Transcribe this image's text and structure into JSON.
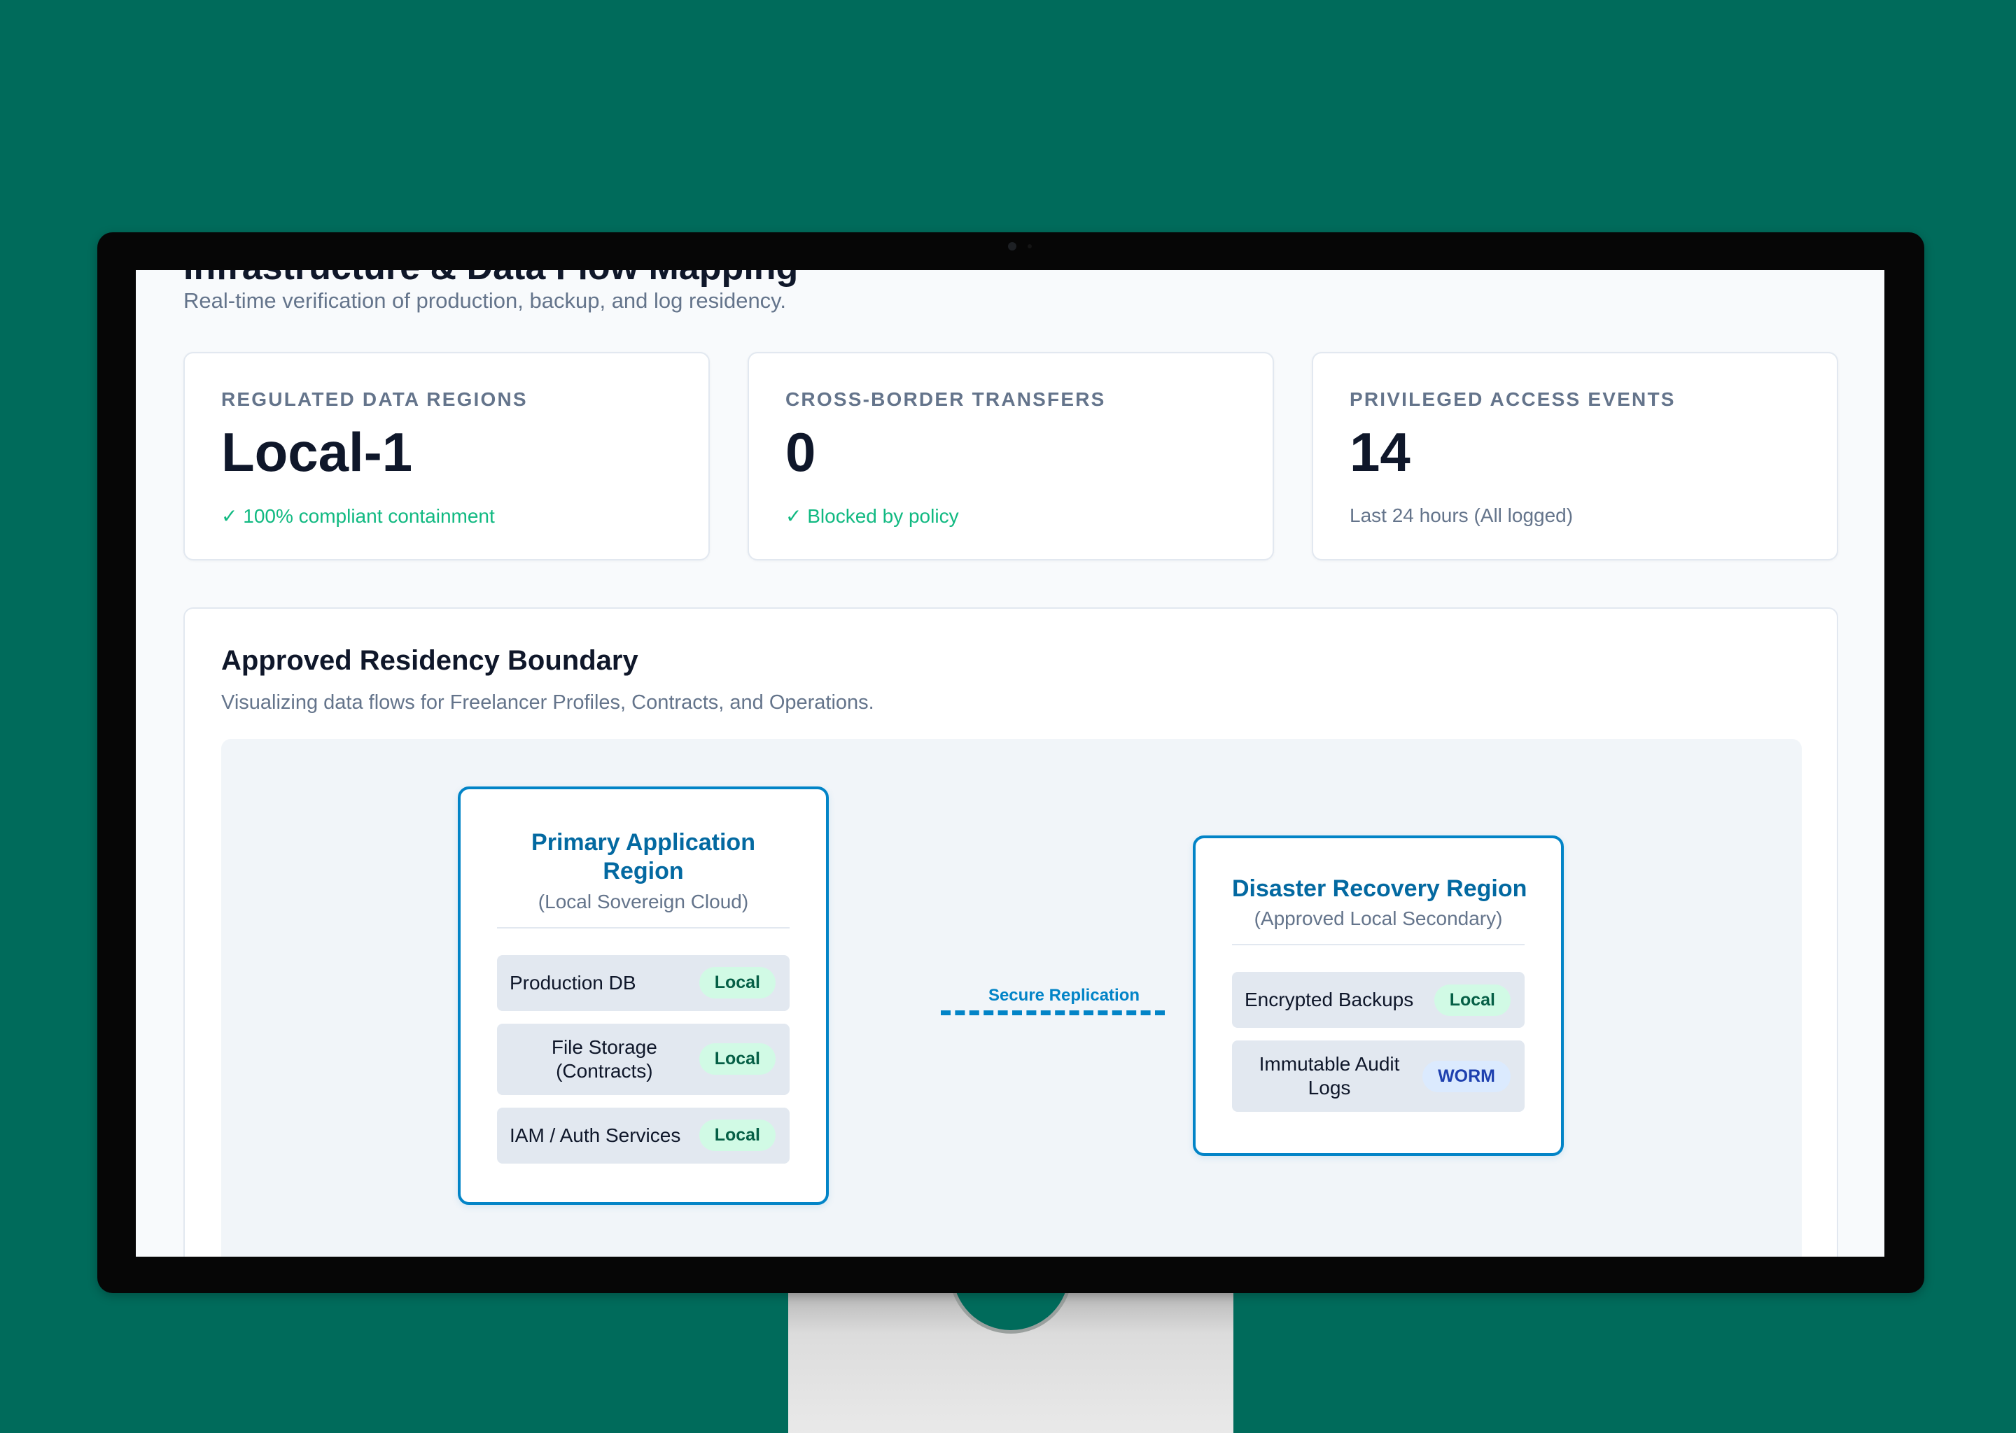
{
  "page": {
    "title": "Infrastructure & Data Flow Mapping",
    "subtitle": "Real-time verification of production, backup, and log residency."
  },
  "stats": [
    {
      "label": "REGULATED DATA REGIONS",
      "value": "Local-1",
      "note": "✓ 100% compliant containment",
      "note_status": "ok"
    },
    {
      "label": "CROSS-BORDER TRANSFERS",
      "value": "0",
      "note": "✓ Blocked by policy",
      "note_status": "ok"
    },
    {
      "label": "PRIVILEGED ACCESS EVENTS",
      "value": "14",
      "note": "Last 24 hours (All logged)",
      "note_status": "muted"
    }
  ],
  "boundary": {
    "title": "Approved Residency Boundary",
    "subtitle": "Visualizing data flows for Freelancer Profiles, Contracts, and Operations.",
    "replication_label": "Secure Replication",
    "primary": {
      "title": "Primary Application Region",
      "sub": "(Local Sovereign Cloud)",
      "services": [
        {
          "name": "Production DB",
          "tag": "Local"
        },
        {
          "name": "File Storage (Contracts)",
          "tag": "Local"
        },
        {
          "name": "IAM / Auth Services",
          "tag": "Local"
        }
      ]
    },
    "dr": {
      "title": "Disaster Recovery Region",
      "sub": "(Approved Local Secondary)",
      "services": [
        {
          "name": "Encrypted Backups",
          "tag": "Local"
        },
        {
          "name": "Immutable Audit Logs",
          "tag": "WORM"
        }
      ]
    }
  },
  "colors": {
    "background": "#006b5b",
    "accent": "#0284c7",
    "success": "#10b981",
    "tag_local_bg": "#d1fae5",
    "tag_worm_bg": "#dbeafe"
  }
}
